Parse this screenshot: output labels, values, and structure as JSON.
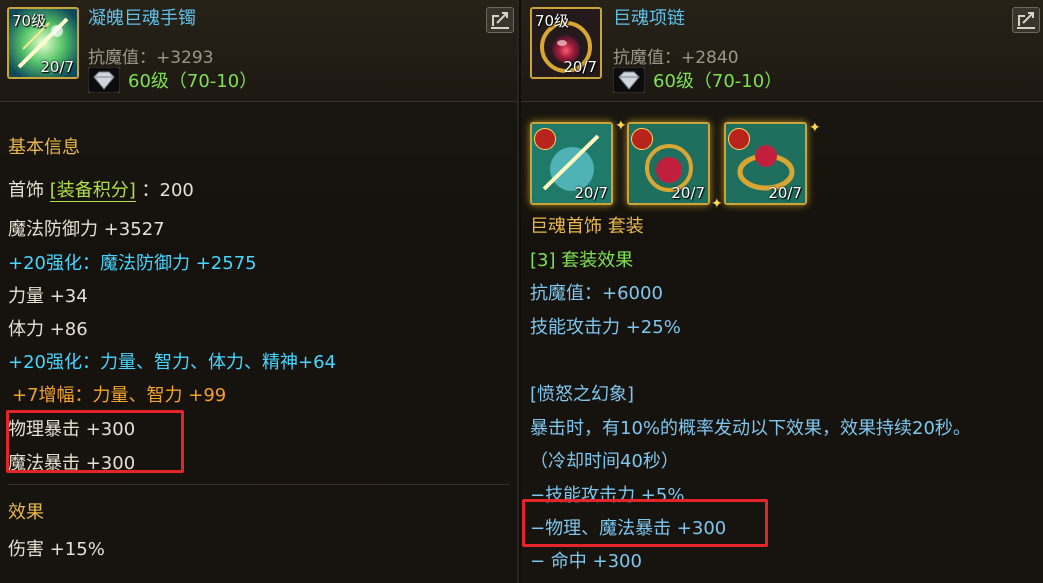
{
  "left": {
    "item": {
      "level": "70级",
      "count": "20/7",
      "name": "凝魄巨魂手镯",
      "stat": "抗魔值：+3293",
      "grade": "60级（70-10）"
    },
    "section_basic": "基本信息",
    "lines": {
      "slot_prefix": "首饰",
      "score_label": "[装备积分]",
      "score_value": "：200",
      "magic_def": "魔法防御力 +3527",
      "reinforce_magic_def": "+20强化：魔法防御力 +2575",
      "strength": "力量 +34",
      "vitality": "体力 +86",
      "reinforce_stats": "+20强化：力量、智力、体力、精神+64",
      "amplify": "+7增幅：力量、智力 +99",
      "phys_crit": "物理暴击 +300",
      "magic_crit": "魔法暴击 +300"
    },
    "section_effect": "效果",
    "effect_damage": "伤害 +15%"
  },
  "right": {
    "item": {
      "level": "70级",
      "count": "20/7",
      "name": "巨魂项链",
      "stat": "抗魔值：+2840",
      "grade": "60级（70-10）"
    },
    "set_icons": [
      {
        "count": "20/7",
        "icon": "bracelet-icon"
      },
      {
        "count": "20/7",
        "icon": "necklace-icon"
      },
      {
        "count": "20/7",
        "icon": "ring-icon"
      }
    ],
    "set_name": "巨魂首饰 套装",
    "set_effect_title": "[3] 套装效果",
    "set_stat1": "抗魔值：+6000",
    "set_stat2": "技能攻击力 +25%",
    "fury_title": "[愤怒之幻象]",
    "fury_desc": "暴击时，有10%的概率发动以下效果，效果持续20秒。",
    "fury_cooldown": "（冷却时间40秒）",
    "fury_skill": "−技能攻击力 +5%",
    "fury_crit": "−物理、魔法暴击 +300",
    "fury_hit": "− 命中 +300"
  },
  "colors": {
    "item_name": "#5fc0ea",
    "reinforce": "#46d6ff",
    "amplify": "#f2a329",
    "section": "#e8b84c",
    "grade": "#7fe052",
    "highlight_box": "#e3252a"
  }
}
